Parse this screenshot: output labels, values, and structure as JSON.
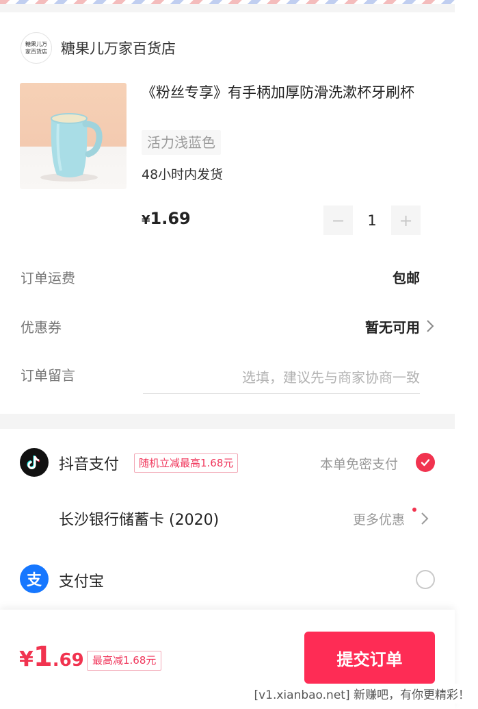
{
  "shop": {
    "logo_text": "糖果儿万家百货店",
    "logo_line1": "糖果儿万",
    "logo_line2": "家百货店",
    "name": "糖果儿万家百货店"
  },
  "product": {
    "title": "《粉丝专享》有手柄加厚防滑洗漱杯牙刷杯",
    "variant": "活力浅蓝色",
    "shipping_note": "48小时内发货",
    "price_symbol": "¥",
    "price": "1.69",
    "quantity": "1",
    "minus": "−",
    "plus": "+"
  },
  "order": {
    "shipping_label": "订单运费",
    "shipping_value": "包邮",
    "coupon_label": "优惠券",
    "coupon_value": "暂无可用",
    "message_label": "订单留言",
    "message_placeholder": "选填，建议先与商家协商一致"
  },
  "payment": {
    "douyin_name": "抖音支付",
    "douyin_promo": "随机立减最高1.68元",
    "douyin_note": "本单免密支付",
    "bank_card": "长沙银行储蓄卡 (2020)",
    "more_offers": "更多优惠",
    "alipay_name": "支付宝",
    "alipay_icon_char": "支"
  },
  "bottom": {
    "total_symbol": "¥",
    "total_int": "1",
    "total_dec": ".69",
    "discount_tag": "最高减1.68元",
    "submit_label": "提交订单"
  },
  "watermark": "[v1.xianbao.net] 新赚吧，有你更精彩！",
  "colors": {
    "accent": "#fe2c55",
    "promo_red": "#f0365b",
    "gap_gray": "#f4f4f4"
  },
  "icons": [
    "douyin-logo-icon",
    "alipay-logo-icon",
    "checkmark-icon",
    "chevron-right-icon"
  ]
}
